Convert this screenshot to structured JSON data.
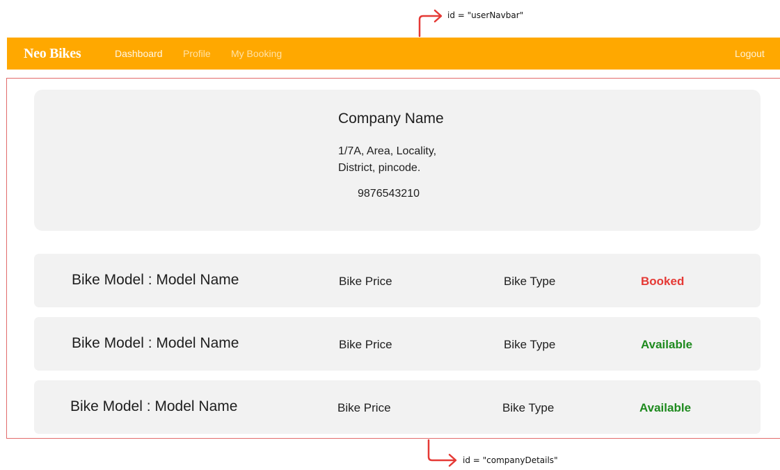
{
  "annotations": {
    "navbar_id_label": "id = \"userNavbar\"",
    "company_id_label": "id = \"companyDetails\""
  },
  "colors": {
    "navbar_bg": "#ffa800",
    "booked": "#e53935",
    "available": "#1e8a1e",
    "card_bg": "#f2f2f2",
    "annotation_arrow": "#e53935"
  },
  "navbar": {
    "brand": "Neo Bikes",
    "links": [
      "Dashboard",
      "Profile",
      "My Booking"
    ],
    "logout": "Logout"
  },
  "company": {
    "name": "Company Name",
    "address_line1": "1/7A, Area, Locality,",
    "address_line2": "District, pincode.",
    "phone": "9876543210"
  },
  "bikes": [
    {
      "model": "Bike Model : Model Name",
      "price": "Bike Price",
      "type": "Bike Type",
      "status": "Booked"
    },
    {
      "model": "Bike Model : Model Name",
      "price": "Bike Price",
      "type": "Bike Type",
      "status": "Available"
    },
    {
      "model": "Bike Model : Model Name",
      "price": "Bike Price",
      "type": "Bike Type",
      "status": "Available"
    }
  ]
}
